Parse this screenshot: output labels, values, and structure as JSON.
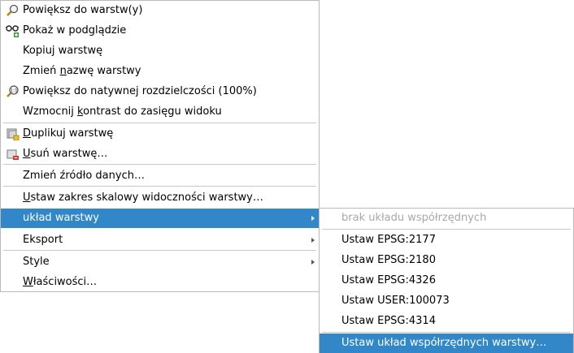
{
  "main_menu": {
    "items": [
      {
        "pre": "Powiększ do warstw(y)",
        "key": "",
        "post": ""
      },
      {
        "pre": "Pokaż w podglądzie",
        "key": "",
        "post": ""
      },
      {
        "pre": "Kopiuj warstwę",
        "key": "",
        "post": ""
      },
      {
        "pre": "Zmień ",
        "key": "n",
        "post": "azwę warstwy"
      },
      {
        "pre": "Powiększ do natywnej rozdzielczości (100%)",
        "key": "",
        "post": ""
      },
      {
        "pre": "Wzmocnij ",
        "key": "k",
        "post": "ontrast do zasięgu widoku"
      },
      {
        "pre": "",
        "key": "D",
        "post": "uplikuj warstwę"
      },
      {
        "pre": "",
        "key": "U",
        "post": "suń warstwę…"
      },
      {
        "pre": "Zmień źródło danych…",
        "key": "",
        "post": ""
      },
      {
        "pre": "",
        "key": "U",
        "post": "staw zakres skalowy widoczności warstwy…"
      },
      {
        "pre": "układ warstwy",
        "key": "",
        "post": ""
      },
      {
        "pre": "Eksport",
        "key": "",
        "post": ""
      },
      {
        "pre": "Style",
        "key": "",
        "post": ""
      },
      {
        "pre": "",
        "key": "W",
        "post": "łaściwości…"
      }
    ]
  },
  "sub_menu": {
    "items": [
      "brak układu współrzędnych",
      "Ustaw EPSG:2177",
      "Ustaw EPSG:2180",
      "Ustaw EPSG:4326",
      "Ustaw USER:100073",
      "Ustaw EPSG:4314",
      "Ustaw układ współrzędnych warstwy…"
    ]
  },
  "colors": {
    "highlight": "#3187c8",
    "disabled_text": "#a8a8a8"
  }
}
